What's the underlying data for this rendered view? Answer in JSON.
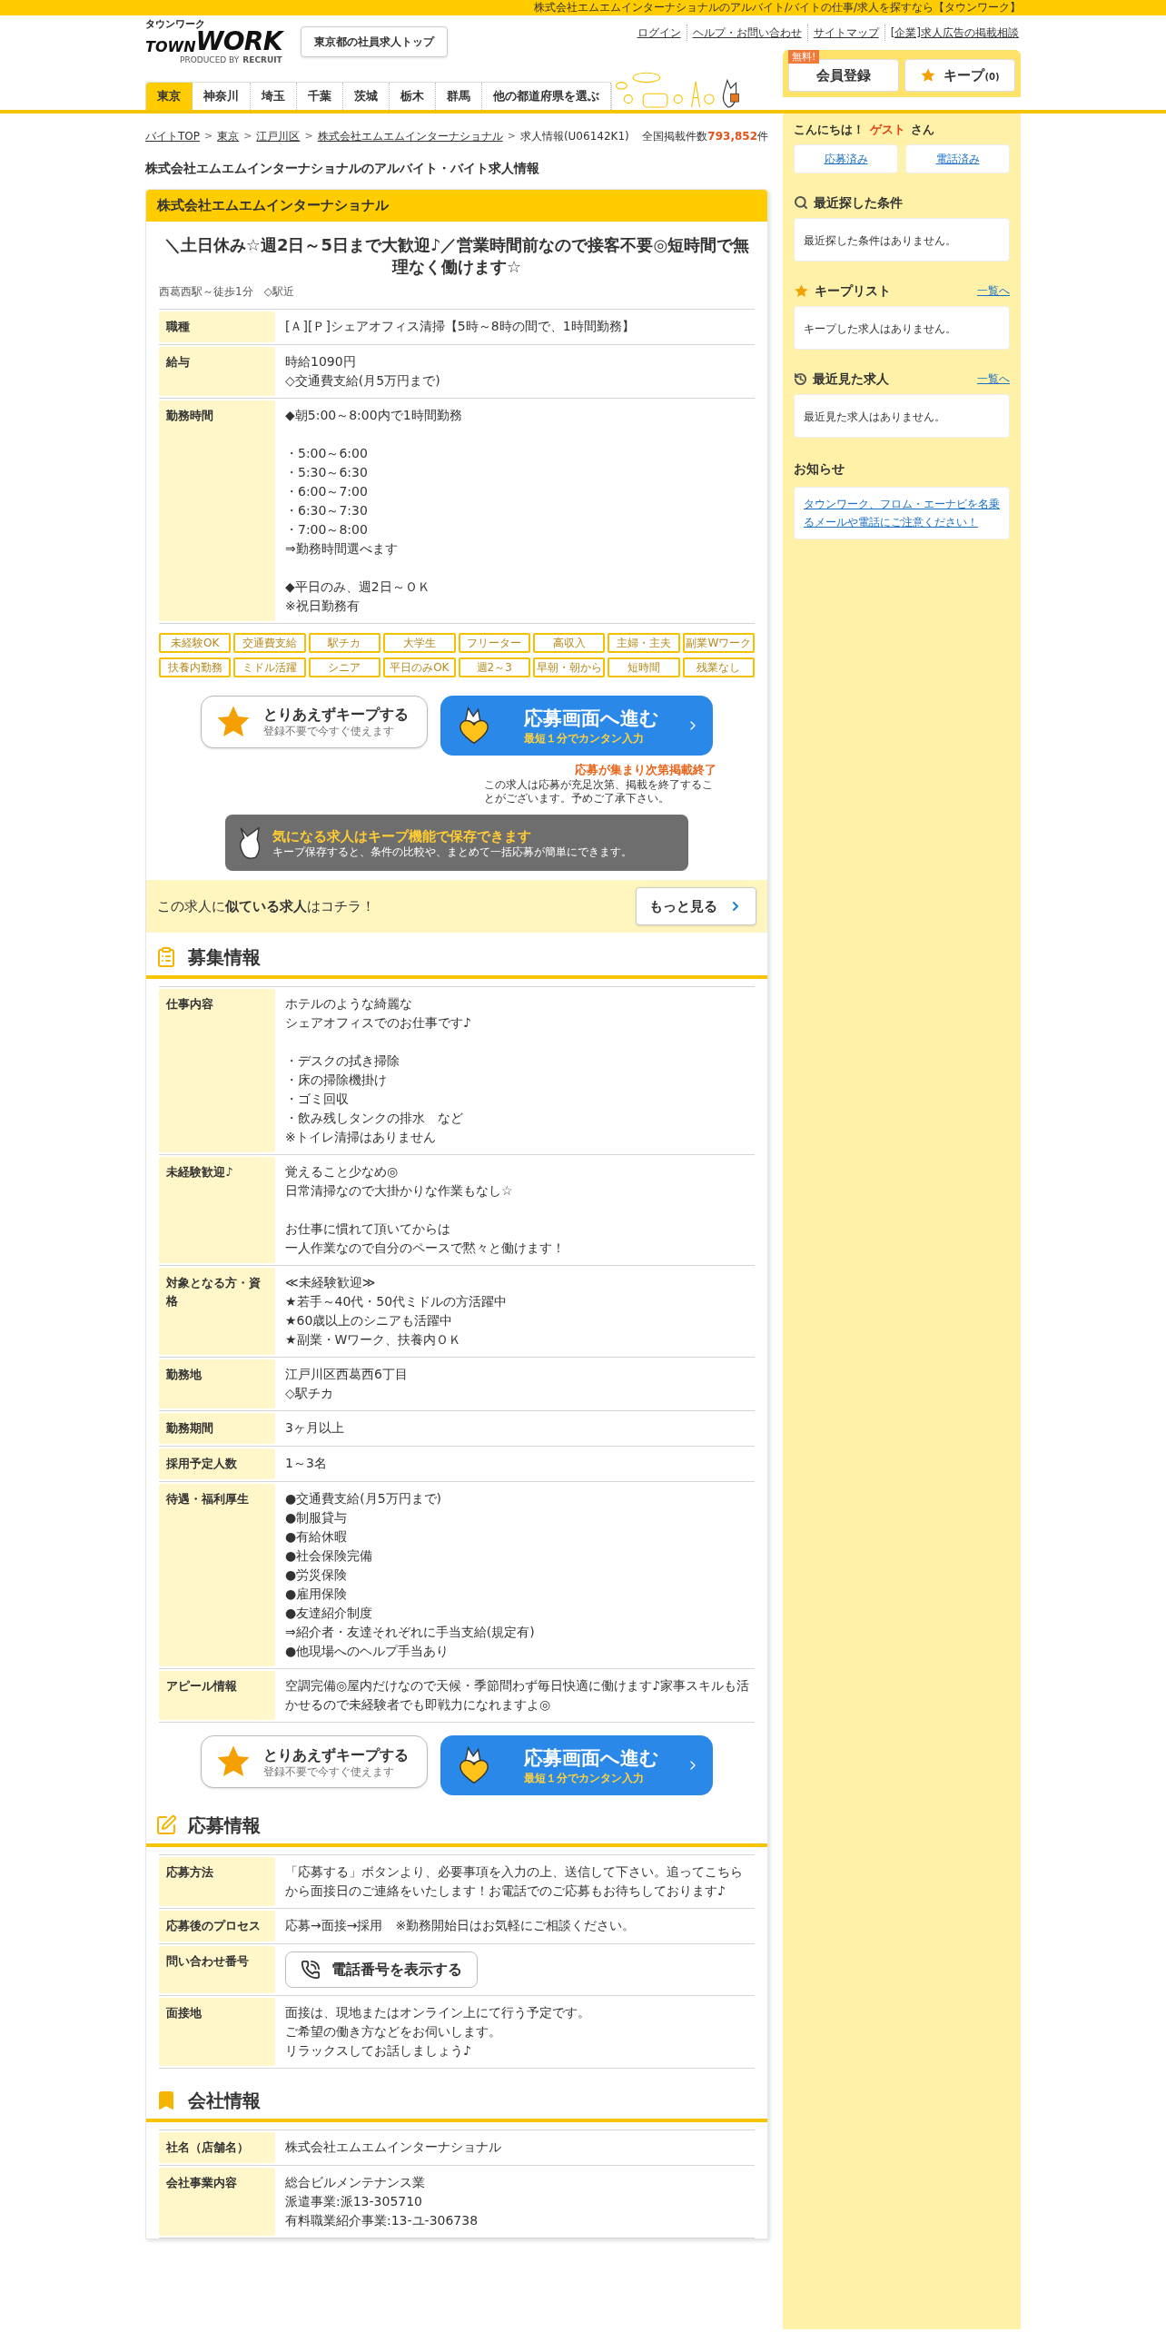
{
  "top_bar": {
    "text": "株式会社エムエムインターナショナルのアルバイト/バイトの仕事/求人を探すなら【タウンワーク】"
  },
  "logo": {
    "kana": "タウンワーク",
    "town": "TOWN",
    "work": "WORK",
    "produced_by": "PRODUCED BY",
    "recruit": "RECRUIT"
  },
  "header_button": "東京都の社員求人トップ",
  "header_links": [
    "ログイン",
    "ヘルプ・お問い合わせ",
    "サイトマップ",
    "[企業]求人広告の掲載相談"
  ],
  "member": {
    "badge": "無料!",
    "register": "会員登録",
    "keep": "キープ",
    "keep_count": "(0)"
  },
  "prefecture_tabs": [
    {
      "label": "東京",
      "selected": true
    },
    {
      "label": "神奈川",
      "selected": false
    },
    {
      "label": "埼玉",
      "selected": false
    },
    {
      "label": "千葉",
      "selected": false
    },
    {
      "label": "茨城",
      "selected": false
    },
    {
      "label": "栃木",
      "selected": false
    },
    {
      "label": "群馬",
      "selected": false
    },
    {
      "label": "他の都道府県を選ぶ",
      "selected": false
    }
  ],
  "breadcrumb": [
    {
      "label": "バイトTOP",
      "kind": "link"
    },
    {
      "separator": ">",
      "label": "東京",
      "kind": "link"
    },
    {
      "separator": ">",
      "label": "江戸川区",
      "kind": "link"
    },
    {
      "separator": ">",
      "label": "株式会社エムエムインターナショナル",
      "kind": "link"
    },
    {
      "separator": ">",
      "label": "求人情報(U06142K1)",
      "kind": "current"
    }
  ],
  "total": {
    "label": "全国掲載件数",
    "count": "793,852",
    "unit": "件"
  },
  "page_title": "株式会社エムエムインターナショナルのアルバイト・バイト求人情報",
  "card": {
    "company": "株式会社エムエムインターナショナル",
    "catch": "＼土日休み☆週2日～5日まで大歓迎♪／営業時間前なので接客不要◎短時間で無理なく働けます☆",
    "access": "西葛西駅～徒歩1分　◇駅近",
    "summary": [
      {
        "label": "職種",
        "kind": "text",
        "paragraphs": [
          [
            "[Ａ][Ｐ]シェアオフィス清掃【5時～8時の間で、1時間勤務】"
          ]
        ]
      },
      {
        "label": "給与",
        "kind": "text",
        "paragraphs": [
          [
            "時給1090円",
            "◇交通費支給(月5万円まで)"
          ]
        ]
      },
      {
        "label": "勤務時間",
        "kind": "text",
        "paragraphs": [
          [
            "◆朝5:00～8:00内で1時間勤務"
          ],
          [
            "・5:00～6:00",
            "・5:30～6:30",
            "・6:00～7:00",
            "・6:30～7:30",
            "・7:00～8:00",
            "⇒勤務時間選べます"
          ],
          [
            "◆平日のみ、週2日～ＯＫ",
            "※祝日勤務有"
          ]
        ]
      }
    ],
    "tags": [
      "未経験OK",
      "交通費支給",
      "駅チカ",
      "大学生",
      "フリーター",
      "高収入",
      "主婦・主夫",
      "副業Wワーク",
      "扶養内勤務",
      "ミドル活躍",
      "シニア",
      "平日のみOK",
      "週2～3",
      "早朝・朝から",
      "短時間",
      "残業なし"
    ]
  },
  "action_rows": [
    {
      "keep_title": "とりあえずキープする",
      "keep_sub": "登録不要で今すぐ使えます",
      "apply_title": "応募画面へ進む",
      "apply_sub": "最短１分でカンタン入力"
    },
    {
      "keep_title": "とりあえずキープする",
      "keep_sub": "登録不要で今すぐ使えます",
      "apply_title": "応募画面へ進む",
      "apply_sub": "最短１分でカンタン入力"
    }
  ],
  "notice": {
    "title": "応募が集まり次第掲載終了",
    "text": "この求人は応募が充足次第、掲載を終了することがございます。予めご了承下さい。"
  },
  "keep_banner": {
    "title": "気になる求人はキープ機能で保存できます",
    "text": "キープ保存すると、条件の比較や、まとめて一括応募が簡単にできます。"
  },
  "similar": {
    "text": "この求人に**似ている求人**はコチラ！",
    "button": "もっと見る"
  },
  "sections": [
    {
      "kind": "recruit",
      "title": "募集情報",
      "rows": [
        {
          "label": "仕事内容",
          "kind": "text",
          "paragraphs": [
            [
              "ホテルのような綺麗な",
              "シェアオフィスでのお仕事です♪"
            ],
            [
              "・デスクの拭き掃除",
              "・床の掃除機掛け",
              "・ゴミ回収",
              "・飲み残しタンクの排水　など",
              "※トイレ清掃はありません"
            ]
          ]
        },
        {
          "label": "未経験歓迎♪",
          "kind": "text",
          "paragraphs": [
            [
              "覚えること少なめ◎",
              "日常清掃なので大掛かりな作業もなし☆"
            ],
            [
              "お仕事に慣れて頂いてからは",
              "一人作業なので自分のペースで黙々と働けます！"
            ]
          ]
        },
        {
          "label": "対象となる方・資格",
          "kind": "text",
          "paragraphs": [
            [
              "≪未経験歓迎≫",
              "★若手～40代・50代ミドルの方活躍中",
              "★60歳以上のシニアも活躍中",
              "★副業・Wワーク、扶養内ＯＫ"
            ]
          ]
        },
        {
          "label": "勤務地",
          "kind": "text",
          "paragraphs": [
            [
              "江戸川区西葛西6丁目",
              "◇駅チカ"
            ]
          ]
        },
        {
          "label": "勤務期間",
          "kind": "text",
          "paragraphs": [
            [
              "3ヶ月以上"
            ]
          ]
        },
        {
          "label": "採用予定人数",
          "kind": "text",
          "paragraphs": [
            [
              "1～3名"
            ]
          ]
        },
        {
          "label": "待遇・福利厚生",
          "kind": "text",
          "paragraphs": [
            [
              "●交通費支給(月5万円まで)",
              "●制服貸与",
              "●有給休暇",
              "●社会保険完備",
              "●労災保険",
              "●雇用保険",
              "●友達紹介制度",
              "⇒紹介者・友達それぞれに手当支給(規定有)",
              "●他現場へのヘルプ手当あり"
            ]
          ]
        },
        {
          "label": "アピール情報",
          "kind": "text",
          "paragraphs": [
            [
              "空調完備◎屋内だけなので天候・季節問わず毎日快適に働けます♪家事スキルも活かせるので未経験者でも即戦力になれますよ◎"
            ]
          ]
        }
      ]
    },
    {
      "kind": "apply",
      "title": "応募情報",
      "rows": [
        {
          "label": "応募方法",
          "kind": "text",
          "paragraphs": [
            [
              "「応募する」ボタンより、必要事項を入力の上、送信して下さい。追ってこちらから面接日のご連絡をいたします！お電話でのご応募もお待ちしております♪"
            ]
          ]
        },
        {
          "label": "応募後のプロセス",
          "kind": "text",
          "paragraphs": [
            [
              "応募→面接→採用　※勤務開始日はお気軽にご相談ください。"
            ]
          ]
        },
        {
          "label": "問い合わせ番号",
          "kind": "button",
          "button": "電話番号を表示する"
        },
        {
          "label": "面接地",
          "kind": "text",
          "paragraphs": [
            [
              "面接は、現地またはオンライン上にて行う予定です。",
              "ご希望の働き方などをお伺いします。",
              "リラックスしてお話しましょう♪"
            ]
          ]
        }
      ]
    },
    {
      "kind": "company",
      "title": "会社情報",
      "rows": [
        {
          "label": "社名（店舗名）",
          "kind": "text",
          "paragraphs": [
            [
              "株式会社エムエムインターナショナル"
            ]
          ]
        },
        {
          "label": "会社事業内容",
          "kind": "text",
          "paragraphs": [
            [
              "総合ビルメンテナンス業",
              "派遣事業:派13-305710",
              "有料職業紹介事業:13-ユ-306738"
            ]
          ]
        }
      ]
    }
  ],
  "sidebar": {
    "greeting": {
      "prefix": "こんにちは！",
      "name": "ゲスト",
      "suffix": "さん"
    },
    "history_buttons": [
      "応募済み",
      "電話済み"
    ],
    "panels": [
      {
        "kind": "search",
        "title": "最近探した条件",
        "text": "最近探した条件はありません。"
      },
      {
        "kind": "keep",
        "title": "キープリスト",
        "link": "一覧へ",
        "text": "キープした求人はありません。"
      },
      {
        "kind": "history",
        "title": "最近見た求人",
        "link": "一覧へ",
        "text": "最近見た求人はありません。"
      }
    ],
    "news": {
      "title": "お知らせ",
      "link": "タウンワーク、フロム・エーナビを名乗るメールや電話にご注意ください！"
    }
  }
}
